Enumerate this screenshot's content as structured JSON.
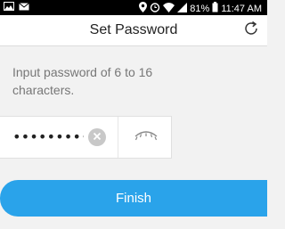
{
  "status_bar": {
    "battery": "81%",
    "time": "11:47 AM",
    "icons": [
      "image-icon",
      "mail-icon",
      "location-icon",
      "alarm-icon",
      "wifi-icon",
      "signal-icon",
      "battery-icon"
    ]
  },
  "header": {
    "title": "Set Password",
    "refresh_icon": "refresh-icon"
  },
  "instruction": "Input password of 6 to 16 characters.",
  "password": {
    "value": "••••••••••",
    "clear_icon": "clear-icon",
    "visibility_icon": "eye-closed-icon"
  },
  "finish_button": {
    "label": "Finish"
  },
  "colors": {
    "accent": "#2aa3ea",
    "background": "#f2f2f2",
    "status_bar": "#000000"
  }
}
